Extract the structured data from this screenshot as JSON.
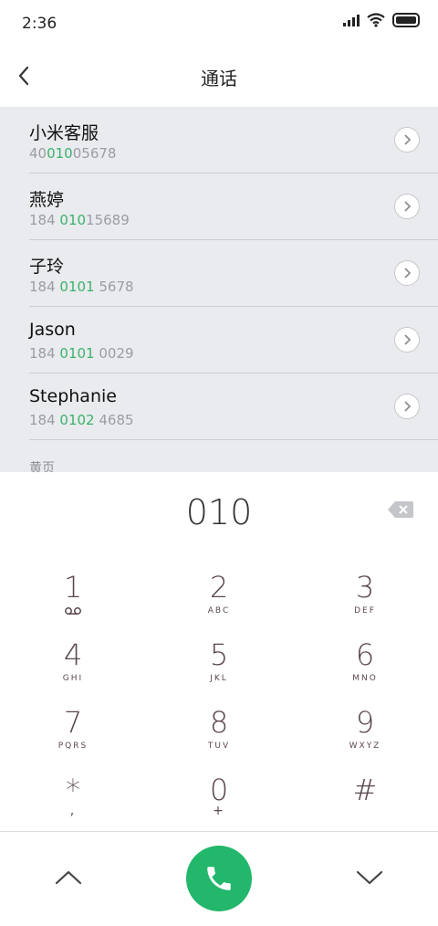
{
  "status": {
    "time": "2:36"
  },
  "header": {
    "title": "通话"
  },
  "results": [
    {
      "name": "小米客服",
      "num_pre": "40",
      "num_hl": "010",
      "num_post": "05678"
    },
    {
      "name": "燕婷",
      "num_pre": "184 ",
      "num_hl": "010",
      "num_post": "15689"
    },
    {
      "name": "子玲",
      "num_pre": "184 ",
      "num_hl": "0101",
      "num_post": " 5678"
    },
    {
      "name": "Jason",
      "num_pre": "184 ",
      "num_hl": "0101",
      "num_post": " 0029"
    },
    {
      "name": "Stephanie",
      "num_pre": "184 ",
      "num_hl": "0102",
      "num_post": " 4685"
    }
  ],
  "section_label": "黄页",
  "input": {
    "digits": "010"
  },
  "keypad": [
    {
      "digit": "1",
      "letters": "oo"
    },
    {
      "digit": "2",
      "letters": "ABC"
    },
    {
      "digit": "3",
      "letters": "DEF"
    },
    {
      "digit": "4",
      "letters": "GHI"
    },
    {
      "digit": "5",
      "letters": "JKL"
    },
    {
      "digit": "6",
      "letters": "MNO"
    },
    {
      "digit": "7",
      "letters": "PQRS"
    },
    {
      "digit": "8",
      "letters": "TUV"
    },
    {
      "digit": "9",
      "letters": "WXYZ"
    },
    {
      "digit": "*",
      "letters": ","
    },
    {
      "digit": "0",
      "letters": "+"
    },
    {
      "digit": "#",
      "letters": ""
    }
  ],
  "colors": {
    "accent": "#22b76a",
    "highlight": "#3bb36a"
  }
}
